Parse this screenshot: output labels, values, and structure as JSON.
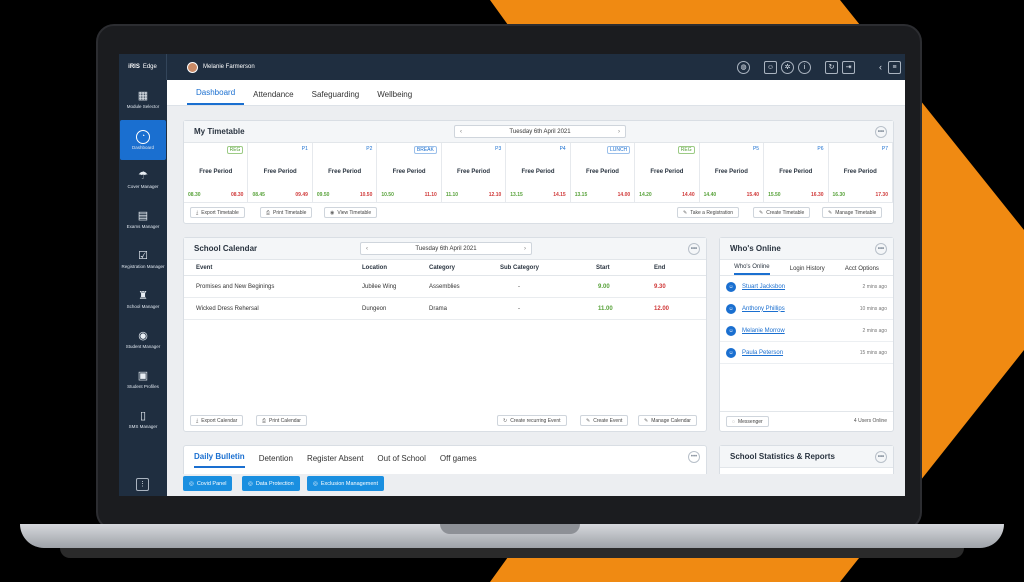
{
  "app": {
    "logo_brand": "iRIS",
    "logo_product": "Edge",
    "user_name": "Melanie Farmerson"
  },
  "topbar_icons": [
    "globe-icon",
    "user-icon",
    "gear-icon",
    "info-icon",
    "refresh-icon",
    "logout-icon",
    "chevron-left-icon",
    "menu-icon"
  ],
  "sidebar": {
    "items": [
      {
        "label": "Module Selector",
        "icon": "grid-icon",
        "glyph": "▦"
      },
      {
        "label": "Dashboard",
        "icon": "gauge-icon",
        "glyph": "◔"
      },
      {
        "label": "Cover Manager",
        "icon": "umbrella-icon",
        "glyph": "☂"
      },
      {
        "label": "Exams Manager",
        "icon": "clipboard-icon",
        "glyph": "▤"
      },
      {
        "label": "Registration Manager",
        "icon": "checklist-icon",
        "glyph": "☑"
      },
      {
        "label": "School Manager",
        "icon": "org-chart-icon",
        "glyph": "♜"
      },
      {
        "label": "Student Manager",
        "icon": "student-icon",
        "glyph": "◉"
      },
      {
        "label": "Student Profiles",
        "icon": "id-card-icon",
        "glyph": "▣"
      },
      {
        "label": "SMS Manager",
        "icon": "phone-icon",
        "glyph": "▯"
      }
    ],
    "bottom_glyph": "⋮"
  },
  "tabs": [
    "Dashboard",
    "Attendance",
    "Safeguarding",
    "Wellbeing"
  ],
  "timetable": {
    "title": "My Timetable",
    "date": "Tuesday 6th April 2021",
    "periods": [
      {
        "code": "REG",
        "label": "Free Period",
        "start": "08.30",
        "end": "08.30"
      },
      {
        "code": "P1",
        "label": "Free Period",
        "start": "08.45",
        "end": "09.49"
      },
      {
        "code": "P2",
        "label": "Free Period",
        "start": "09.50",
        "end": "10.50"
      },
      {
        "code": "BREAK",
        "label": "Free Period",
        "start": "10.50",
        "end": "11.10"
      },
      {
        "code": "P3",
        "label": "Free Period",
        "start": "11.10",
        "end": "12.10"
      },
      {
        "code": "P4",
        "label": "Free Period",
        "start": "13.15",
        "end": "14.15"
      },
      {
        "code": "LUNCH",
        "label": "Free Period",
        "start": "13.15",
        "end": "14.00"
      },
      {
        "code": "REG",
        "label": "Free Period",
        "start": "14.20",
        "end": "14.40"
      },
      {
        "code": "P5",
        "label": "Free Period",
        "start": "14.40",
        "end": "15.40"
      },
      {
        "code": "P6",
        "label": "Free Period",
        "start": "15.50",
        "end": "16.30"
      },
      {
        "code": "P7",
        "label": "Free Period",
        "start": "16.30",
        "end": "17.30"
      }
    ],
    "buttons_left": [
      "Export Timetable",
      "Print Timetable",
      "View Timetable"
    ],
    "buttons_right": [
      "Take a Registration",
      "Create Timetable",
      "Manage Timetable"
    ]
  },
  "calendar": {
    "title": "School Calendar",
    "date": "Tuesday 6th April 2021",
    "columns": [
      "Event",
      "Location",
      "Category",
      "Sub Category",
      "Start",
      "End"
    ],
    "rows": [
      {
        "event": "Promises and New Beginings",
        "location": "Jubilee Wing",
        "category": "Assemblies",
        "sub": "-",
        "start": "9.00",
        "end": "9.30"
      },
      {
        "event": "Wicked Dress Rehersal",
        "location": "Dungeon",
        "category": "Drama",
        "sub": "-",
        "start": "11.00",
        "end": "12.00"
      }
    ],
    "buttons_left": [
      "Export Calendar",
      "Print Calendar"
    ],
    "buttons_right": [
      "Create recurring Event",
      "Create Event",
      "Manage Calendar"
    ]
  },
  "online": {
    "title": "Who's Online",
    "tabs": [
      "Who's Online",
      "Login History",
      "Acct Options"
    ],
    "users": [
      {
        "name": "Stuart Jacksbon",
        "time": "2 mins ago"
      },
      {
        "name": "Anthony Phillips",
        "time": "10 mins ago"
      },
      {
        "name": "Melanie Morrow",
        "time": "2 mins ago"
      },
      {
        "name": "Paula Peterson",
        "time": "15 mins ago"
      }
    ],
    "messenger": "Messenger",
    "count": "4 Users Online"
  },
  "bulletin": {
    "tabs": [
      "Daily Bulletin",
      "Detention",
      "Register Absent",
      "Out of School",
      "Off games"
    ]
  },
  "stats": {
    "title": "School Statistics & Reports"
  },
  "footer_buttons": [
    "Covid Panel",
    "Data Protection",
    "Exclusion Management"
  ],
  "colors": {
    "accent": "#1a6fd0",
    "sidebar": "#1f2e40",
    "orange": "#f08a12",
    "green": "#58a23a",
    "red": "#d03a3a"
  }
}
